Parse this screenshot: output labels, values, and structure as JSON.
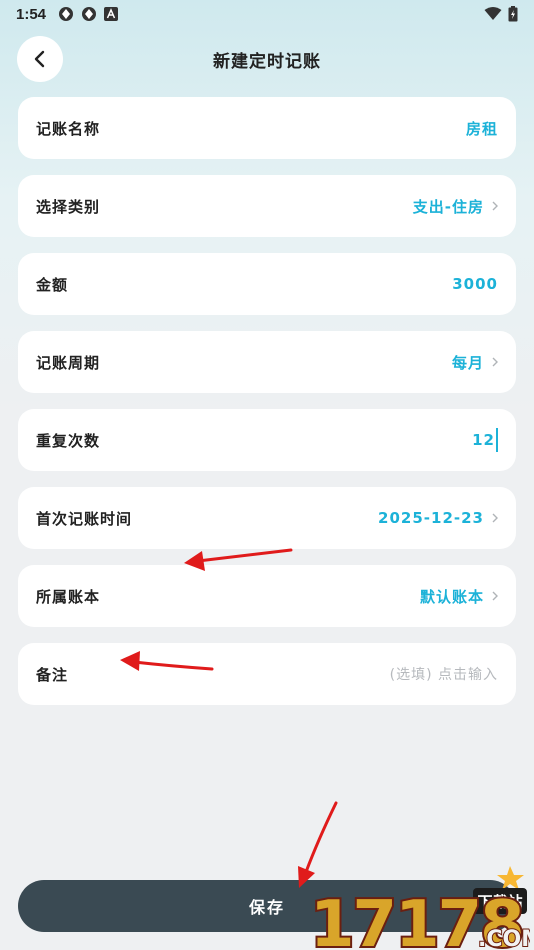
{
  "status_bar": {
    "time": "1:54"
  },
  "header": {
    "title": "新建定时记账"
  },
  "form": {
    "rows": [
      {
        "label": "记账名称",
        "value": "房租"
      },
      {
        "label": "选择类别",
        "value": "支出-住房"
      },
      {
        "label": "金额",
        "value": "3000"
      },
      {
        "label": "记账周期",
        "value": "每月"
      },
      {
        "label": "重复次数",
        "value": "12"
      },
      {
        "label": "首次记账时间",
        "value": "2025-12-23"
      },
      {
        "label": "所属账本",
        "value": "默认账本"
      },
      {
        "label": "备注",
        "placeholder": "(选填) 点击输入"
      }
    ]
  },
  "footer": {
    "save_label": "保存"
  },
  "watermark": {
    "number": "17178",
    "domain": ".COM",
    "tag": "下载站"
  },
  "colors": {
    "accent": "#1cb2d8",
    "button_bg": "#3a4a53",
    "placeholder": "#b6b9bd",
    "annotation": "#e01b1b"
  }
}
